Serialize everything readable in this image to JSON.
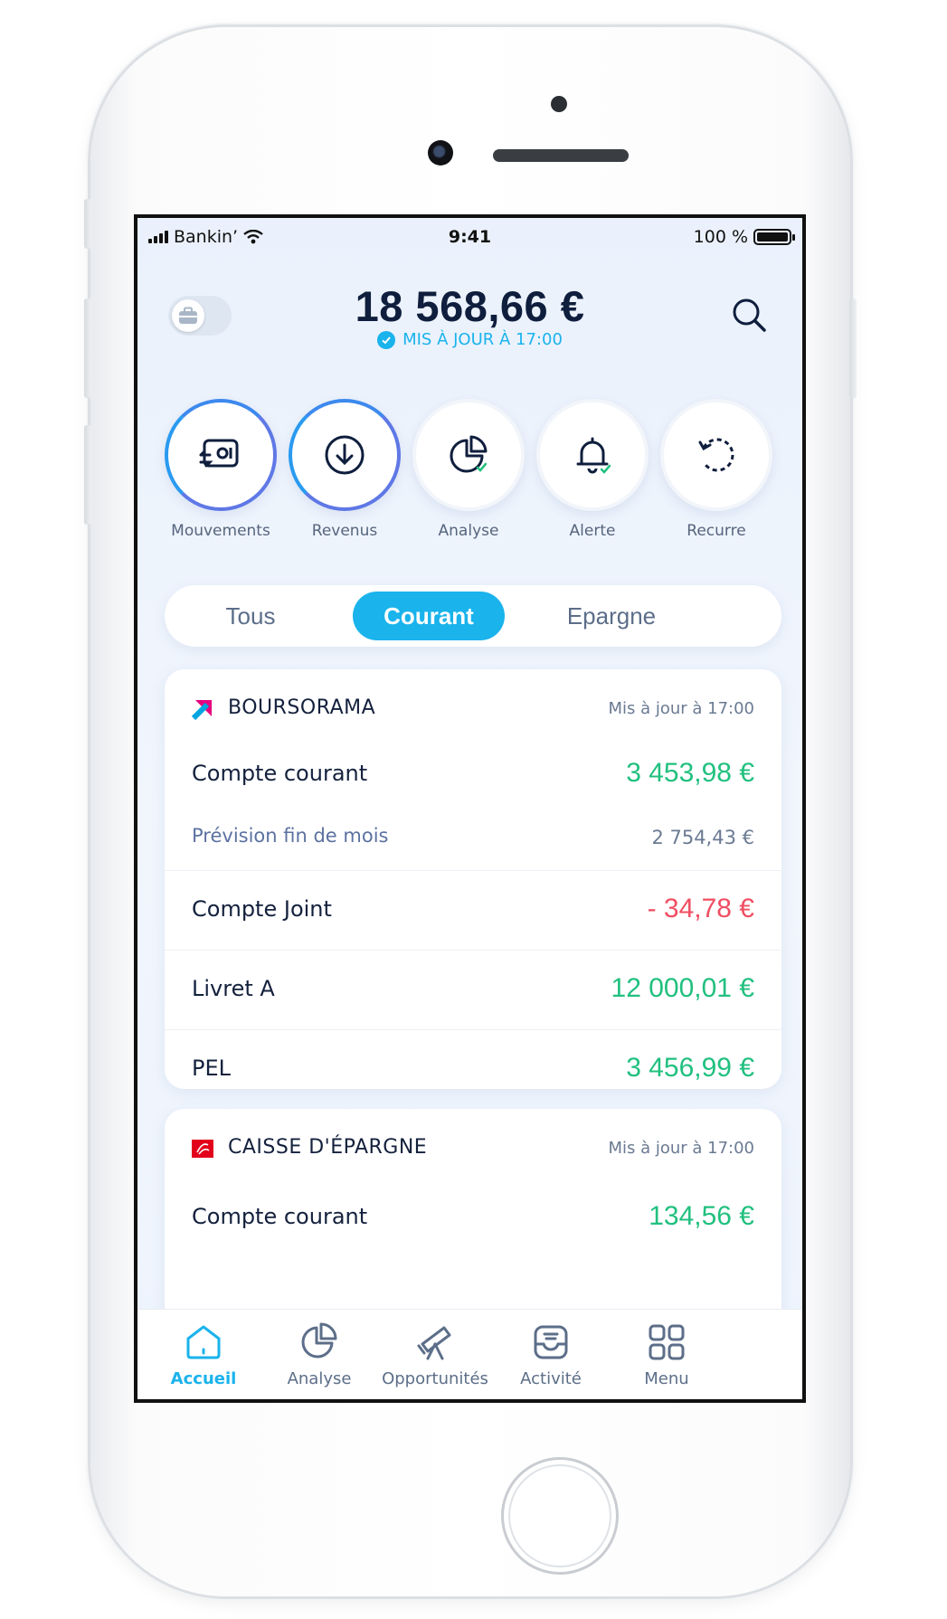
{
  "status_bar": {
    "carrier": "Bankin’",
    "time": "9:41",
    "battery": "100 %"
  },
  "header": {
    "balance": "18 568,66 €",
    "updated": "MIS À JOUR À 17:00"
  },
  "quick_actions": [
    {
      "label": "Mouvements",
      "icon": "transfer-card-icon"
    },
    {
      "label": "Revenus",
      "icon": "download-circle-icon"
    },
    {
      "label": "Analyse",
      "icon": "pie-chart-check-icon"
    },
    {
      "label": "Alerte",
      "icon": "bell-check-icon"
    },
    {
      "label": "Recurre",
      "icon": "recurring-icon"
    }
  ],
  "segments": {
    "items": [
      "Tous",
      "Courant",
      "Epargne"
    ],
    "selected": "Courant"
  },
  "banks": [
    {
      "name": "BOURSORAMA",
      "updated": "Mis à jour à 17:00",
      "accent": "#e5007e",
      "accounts": [
        {
          "label": "Compte courant",
          "amount": "3 453,98 €"
        },
        {
          "label": "Prévision fin de mois",
          "amount": "2 754,43 €"
        },
        {
          "label": "Compte Joint",
          "amount": "- 34,78 €"
        },
        {
          "label": "Livret A",
          "amount": "12 000,01 €"
        },
        {
          "label": "PEL",
          "amount": "3 456,99 €"
        }
      ]
    },
    {
      "name": "CAISSE D'ÉPARGNE",
      "updated": "Mis à jour à 17:00",
      "accent": "#e2001a",
      "accounts": [
        {
          "label": "Compte courant",
          "amount": "134,56 €"
        }
      ]
    }
  ],
  "tabbar": [
    {
      "label": "Accueil",
      "icon": "home-icon",
      "active": true
    },
    {
      "label": "Analyse",
      "icon": "pie-chart-icon",
      "active": false
    },
    {
      "label": "Opportunités",
      "icon": "telescope-icon",
      "active": false
    },
    {
      "label": "Activité",
      "icon": "inbox-icon",
      "active": false
    },
    {
      "label": "Menu",
      "icon": "grid-icon",
      "active": false
    }
  ],
  "colors": {
    "accent": "#1ab3ec",
    "positive": "#21c07f",
    "negative": "#f04e62",
    "text_dark": "#14213d"
  }
}
